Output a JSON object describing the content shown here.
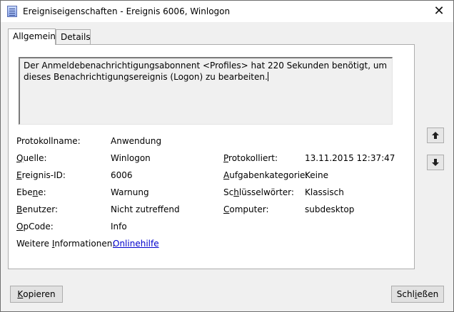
{
  "window": {
    "title": "Ereigniseigenschaften - Ereignis 6006, Winlogon",
    "close_symbol": "✕"
  },
  "tabs": [
    {
      "label": "Allgemein",
      "active": true
    },
    {
      "label": "Details",
      "active": false
    }
  ],
  "description": "Der Anmeldebenachrichtigungsabonnent <Profiles> hat 220 Sekunden benötigt, um dieses Benachrichtigungsereignis (Logon) zu bearbeiten.",
  "fields": {
    "protokollname": {
      "label": "Protokollname:",
      "value": "Anwendung"
    },
    "quelle": {
      "label_u": "Q",
      "label_rest": "uelle:",
      "value": "Winlogon"
    },
    "protokolliert": {
      "label_u": "P",
      "label_rest": "rotokolliert:",
      "value": "13.11.2015 12:37:47"
    },
    "ereignis_id": {
      "label_u": "E",
      "label_rest": "reignis-ID:",
      "value": "6006"
    },
    "aufgabenkategorie": {
      "label_u": "A",
      "label_rest": "ufgabenkategorie:",
      "value": "Keine"
    },
    "ebene": {
      "label_pre": "Ebe",
      "label_u": "n",
      "label_rest": "e:",
      "value": "Warnung"
    },
    "schluesselwoerter": {
      "label_pre": "Sc",
      "label_u": "h",
      "label_rest": "lüsselwörter:",
      "value": "Klassisch"
    },
    "benutzer": {
      "label_u": "B",
      "label_rest": "enutzer:",
      "value": "Nicht zutreffend"
    },
    "computer": {
      "label_u": "C",
      "label_rest": "omputer:",
      "value": "subdesktop"
    },
    "opcode": {
      "label_u": "O",
      "label_rest": "pCode:",
      "value": "Info"
    },
    "weitere": {
      "label_pre": "Weitere ",
      "label_u": "I",
      "label_rest": "nformationen:",
      "link": "Onlinehilfe"
    }
  },
  "nav": {
    "up_icon": "arrow-up-icon",
    "down_icon": "arrow-down-icon"
  },
  "buttons": {
    "copy_u": "K",
    "copy_rest": "opieren",
    "close_pre": "Schl",
    "close_u": "i",
    "close_rest": "eßen"
  }
}
